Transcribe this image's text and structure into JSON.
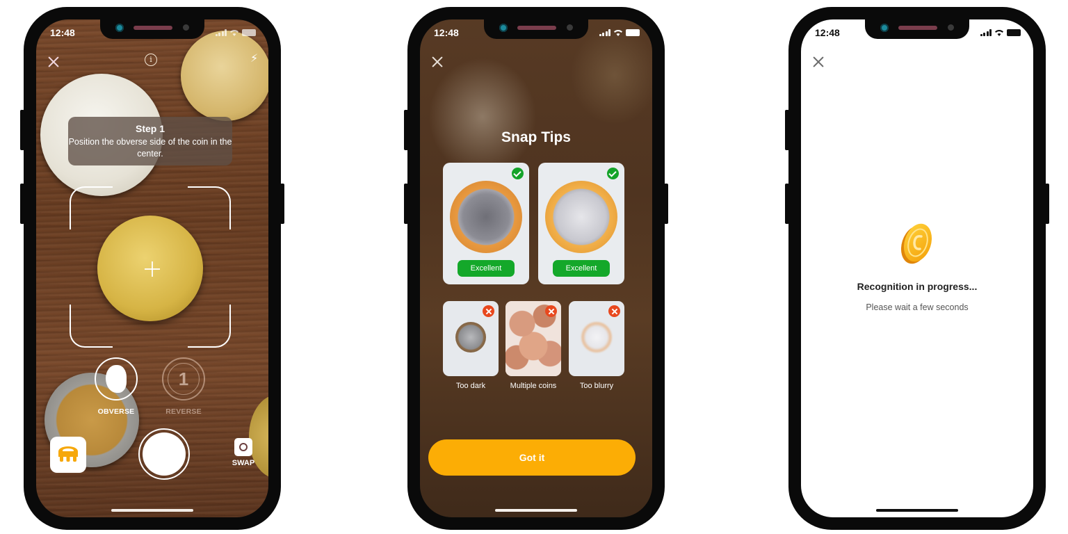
{
  "status_bar": {
    "time": "12:48"
  },
  "camera_screen": {
    "step_title": "Step 1",
    "step_text": "Position the obverse side of the coin in the center.",
    "info_icon": "info-icon",
    "flash_icon": "flash-icon",
    "info_glyph": "i",
    "flash_glyph": "⚡",
    "side_buttons": [
      {
        "label": "OBVERSE",
        "active": true
      },
      {
        "label": "REVERSE",
        "active": false,
        "glyph": "1"
      }
    ],
    "swap_label": "SWAP",
    "close_icon": "close-icon"
  },
  "snap_tips_screen": {
    "title": "Snap Tips",
    "good_examples": [
      {
        "label": "Excellent",
        "status": "check"
      },
      {
        "label": "Excellent",
        "status": "check"
      }
    ],
    "bad_examples": [
      {
        "label": "Too dark",
        "status": "cross"
      },
      {
        "label": "Multiple coins",
        "status": "cross"
      },
      {
        "label": "Too blurry",
        "status": "cross"
      }
    ],
    "button_label": "Got it",
    "accent_color": "#fcad05",
    "success_color": "#14a82a",
    "error_color": "#e8481e"
  },
  "recognition_screen": {
    "title": "Recognition in progress...",
    "subtitle": "Please wait a few seconds"
  }
}
